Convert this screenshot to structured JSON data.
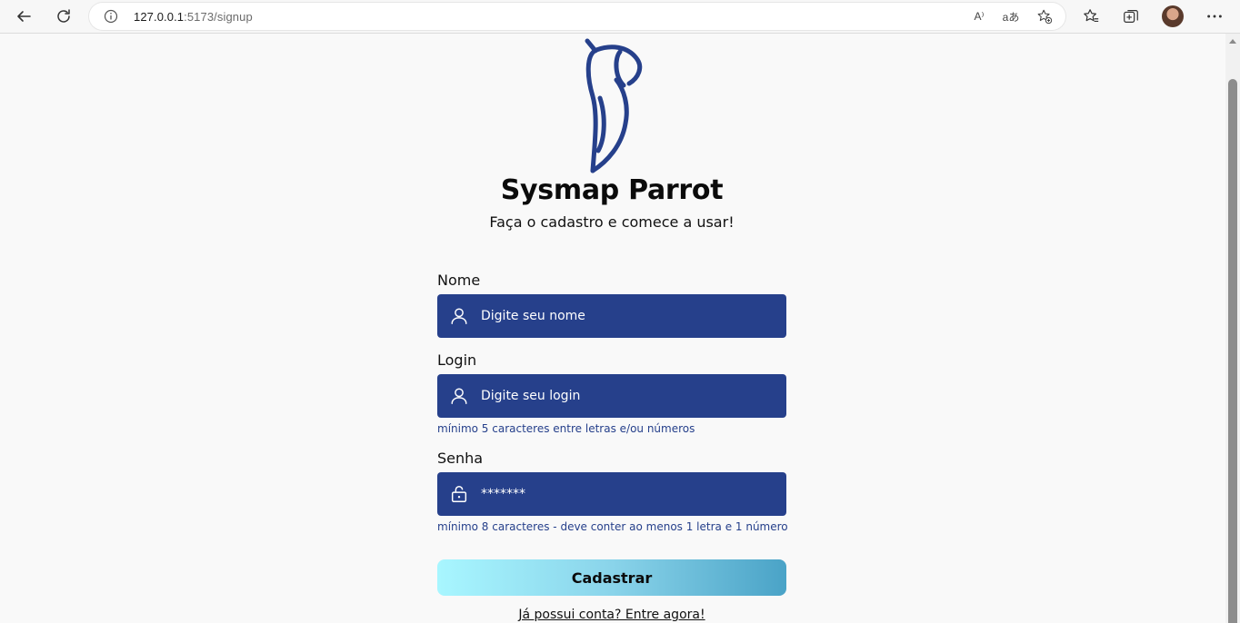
{
  "browser": {
    "url_host": "127.0.0.1",
    "url_rest": ":5173/signup",
    "read_aloud_label": "A⁾",
    "translate_label": "aあ"
  },
  "page": {
    "brand_title": "Sysmap Parrot",
    "brand_subtitle": "Faça o cadastro e comece a usar!",
    "fields": {
      "name": {
        "label": "Nome",
        "placeholder": "Digite seu nome",
        "icon": "user-icon"
      },
      "login": {
        "label": "Login",
        "placeholder": "Digite seu login",
        "hint": "mínimo 5 caracteres entre letras e/ou números",
        "icon": "user-icon"
      },
      "password": {
        "label": "Senha",
        "value": "*******",
        "hint": "mínimo 8 caracteres - deve conter ao menos 1 letra e 1 número",
        "icon": "lock-icon"
      }
    },
    "submit_label": "Cadastrar",
    "signin_link": "Já possui conta? Entre agora!"
  },
  "colors": {
    "field_bg": "#26408b",
    "logo": "#26408b",
    "button_gradient_start": "#a8f6ff",
    "button_gradient_end": "#4aa3c7",
    "page_bg": "#f9f9f9"
  }
}
